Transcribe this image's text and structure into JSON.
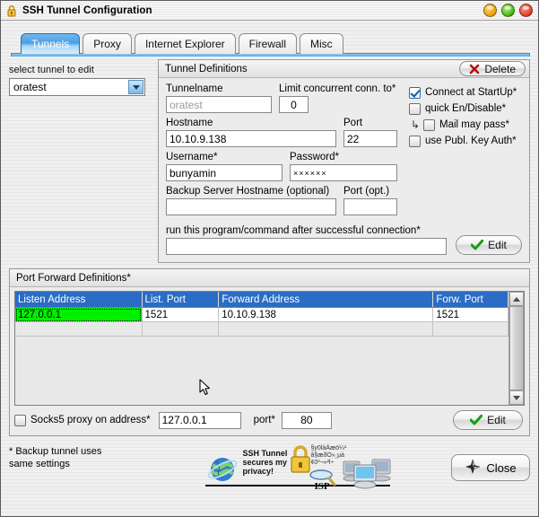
{
  "window": {
    "title": "SSH Tunnel Configuration",
    "icon": "padlock-icon",
    "buttons": {
      "minimize": "minimize",
      "maximize": "maximize",
      "close": "close"
    }
  },
  "tabs": [
    {
      "label": "Tunnels",
      "active": true
    },
    {
      "label": "Proxy",
      "active": false
    },
    {
      "label": "Internet Explorer",
      "active": false
    },
    {
      "label": "Firewall",
      "active": false
    },
    {
      "label": "Misc",
      "active": false
    }
  ],
  "tunnel_selector": {
    "label": "select tunnel to edit",
    "value": "oratest"
  },
  "tunnel_definitions": {
    "title": "Tunnel Definitions",
    "delete_label": "Delete",
    "fields": {
      "tunnelname_label": "Tunnelname",
      "tunnelname_value": "oratest",
      "limit_label": "Limit concurrent conn. to*",
      "limit_value": "0",
      "hostname_label": "Hostname",
      "hostname_value": "10.10.9.138",
      "port_label": "Port",
      "port_value": "22",
      "username_label": "Username*",
      "username_value": "bunyamin",
      "password_label": "Password*",
      "password_value": "××××××",
      "backup_host_label": "Backup Server Hostname (optional)",
      "backup_host_value": "",
      "backup_port_label": "Port (opt.)",
      "backup_port_value": "",
      "runcmd_label": "run this program/command after successful connection*",
      "runcmd_value": "",
      "runcmd_edit_label": "Edit"
    },
    "checkboxes": [
      {
        "label": "Connect at StartUp*",
        "checked": true,
        "indent": false
      },
      {
        "label": "quick En/Disable*",
        "checked": false,
        "indent": false
      },
      {
        "label": "Mail may pass*",
        "checked": false,
        "indent": true
      },
      {
        "label": "use Publ. Key Auth*",
        "checked": false,
        "indent": false
      }
    ]
  },
  "port_forward": {
    "title": "Port Forward Definitions*",
    "columns": [
      "Listen Address",
      "List. Port",
      "Forward Address",
      "Forw. Port"
    ],
    "rows": [
      {
        "cells": [
          "127.0.0.1",
          "1521",
          "10.10.9.138",
          "1521"
        ],
        "selected_cell": 0
      },
      {
        "cells": [
          "",
          "",
          "",
          ""
        ],
        "selected_cell": -1
      }
    ],
    "socks": {
      "checkbox_label": "Socks5 proxy on address*",
      "checked": false,
      "address_value": "127.0.0.1",
      "port_label": "port*",
      "port_value": "80",
      "edit_label": "Edit"
    }
  },
  "footer": {
    "note_line1": "* Backup tunnel uses",
    "note_line2": "same settings",
    "logo_text_line1": "SSH Tunnel",
    "logo_text_line2": "secures my",
    "logo_text_line3": "privacy!",
    "logo_scramble_line1": "§y0làÄæö¼¹",
    "logo_scramble_line2": "â§æðO»¸µà",
    "logo_scramble_line3": "¢0³¬»²l÷",
    "logo_isp_label": "ISP",
    "close_label": "Close"
  },
  "colors": {
    "tab_active": "#4c9fe4",
    "header_blue": "#2b6cc4",
    "selected_cell_green": "#00f000",
    "delete_x": "#b51212",
    "check_green": "#14a014"
  }
}
